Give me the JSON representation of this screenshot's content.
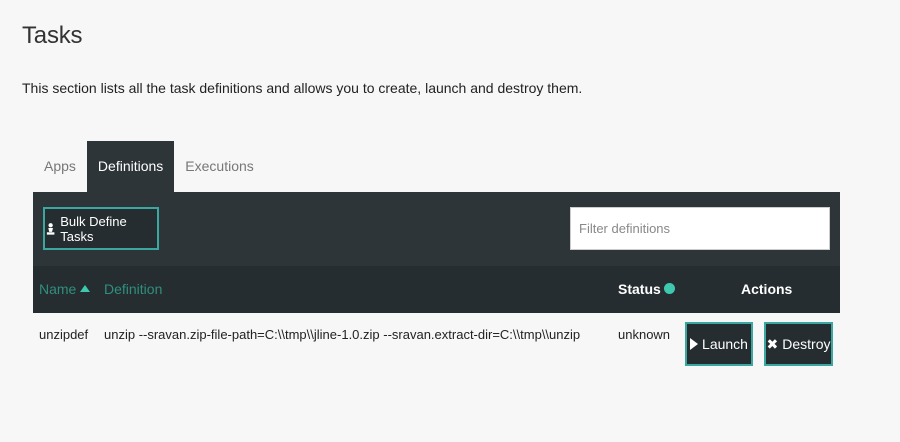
{
  "page": {
    "title": "Tasks",
    "description": "This section lists all the task definitions and allows you to create, launch and destroy them."
  },
  "tabs": [
    {
      "label": "Apps",
      "active": false
    },
    {
      "label": "Definitions",
      "active": true
    },
    {
      "label": "Executions",
      "active": false
    }
  ],
  "toolbar": {
    "bulk_define_label": "Bulk Define Tasks",
    "filter_placeholder": "Filter definitions",
    "filter_value": ""
  },
  "table": {
    "columns": {
      "name": "Name",
      "definition": "Definition",
      "status": "Status",
      "actions": "Actions"
    },
    "rows": [
      {
        "name": "unzipdef",
        "definition": "unzip --sravan.zip-file-path=C:\\\\tmp\\\\jline-1.0.zip --sravan.extract-dir=C:\\\\tmp\\\\unzip",
        "status": "unknown",
        "launch_label": "Launch",
        "destroy_label": "Destroy"
      }
    ]
  },
  "colors": {
    "panel": "#2d3538",
    "accent": "#3aa7a1",
    "link": "#2f8f7e"
  },
  "icons": {
    "sort": "sort-up-icon",
    "info": "info-icon",
    "launch": "play-icon",
    "destroy": "close-icon",
    "bulk": "chess-pawn-icon"
  }
}
